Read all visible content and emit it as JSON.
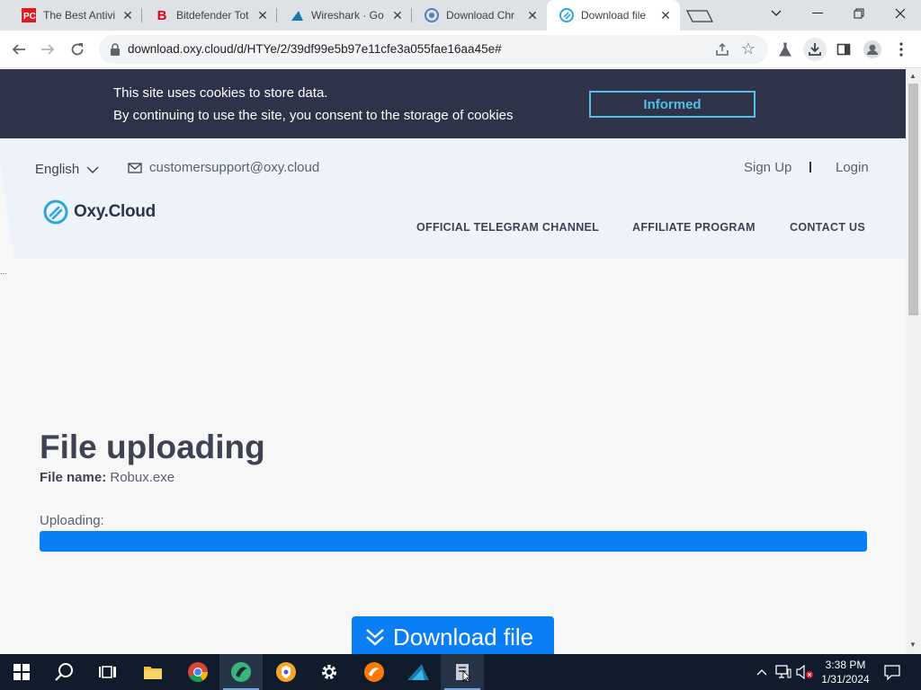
{
  "browser": {
    "tabs": [
      {
        "title": "The Best Antivi",
        "icon": "pcmag-icon"
      },
      {
        "title": "Bitdefender Tot",
        "icon": "bitdefender-icon"
      },
      {
        "title": "Wireshark · Go",
        "icon": "wireshark-icon"
      },
      {
        "title": "Download Chr",
        "icon": "chrome-download-icon"
      },
      {
        "title": "Download file",
        "icon": "oxy-cloud-icon",
        "active": true
      }
    ],
    "url": "download.oxy.cloud/d/HTYe/2/39df99e5b97e11cfe3a055fae16aa45e#"
  },
  "cookie_banner": {
    "line1": "This site uses cookies to store data.",
    "line2": "By continuing to use the site, you consent to the storage of cookies",
    "button": "Informed",
    "accent": "#51bfe9",
    "background": "#2e3349"
  },
  "header": {
    "language": "English",
    "email": "customersupport@oxy.cloud",
    "signup": "Sign Up",
    "login": "Login",
    "logo": "Oxy.Cloud",
    "nav": [
      "OFFICIAL TELEGRAM CHANNEL",
      "AFFILIATE PROGRAM",
      "CONTACT US"
    ]
  },
  "main": {
    "heading": "File uploading",
    "file_name_label": "File name:",
    "file_name": "Robux.exe",
    "uploading_label": "Uploading:",
    "progress_fraction": 1.0,
    "progress_color": "#0a7ff5",
    "download_button": "Download file"
  },
  "page_misc": {
    "dots": "..."
  },
  "taskbar": {
    "apps": [
      "start-icon",
      "search-icon",
      "task-view-icon",
      "file-explorer-icon",
      "chrome-icon",
      "oxy-cloud-app-icon",
      "brave-icon",
      "settings-icon",
      "avast-icon",
      "wireshark-app-icon",
      "unknown-app-icon"
    ],
    "time": "3:38 PM",
    "date": "1/31/2024"
  }
}
